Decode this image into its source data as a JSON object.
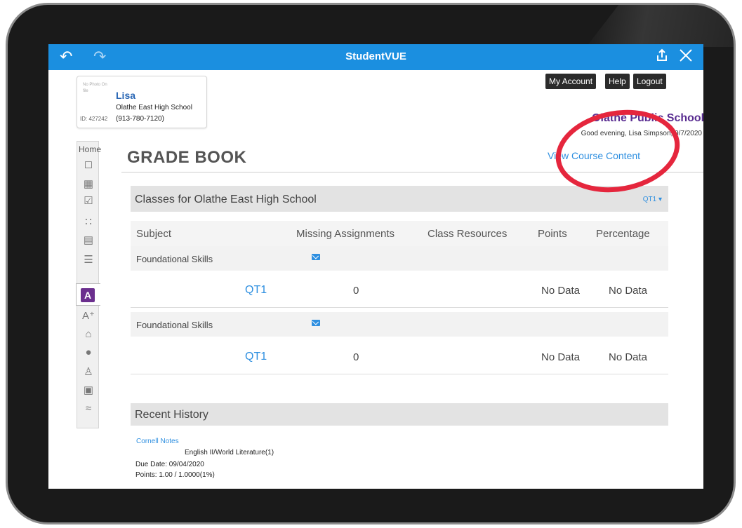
{
  "app": {
    "title": "StudentVUE",
    "back_icon": "back-arrow-icon",
    "forward_icon": "forward-arrow-icon",
    "share_icon": "share-icon",
    "close_icon": "close-icon"
  },
  "student": {
    "photo_text": "No Photo On file",
    "name": "Lisa",
    "school": "Olathe East High School",
    "id": "ID: 427242",
    "phone": "(913-780-7120)"
  },
  "header": {
    "my_account": "My Account",
    "help": "Help",
    "logout": "Logout",
    "district": "Olathe Public Schools",
    "greeting": "Good evening, Lisa Simpson, 9/7/2020"
  },
  "sidebar": {
    "home_label": "Home",
    "icons": [
      "home-icon",
      "calendar-icon",
      "attendance-icon",
      "assessment-icon",
      "class-schedule-icon",
      "course-history-icon",
      "grade-book-icon",
      "report-card-icon",
      "school-info-icon",
      "student-info-icon",
      "conference-icon",
      "lock-icon",
      "test-history-icon"
    ]
  },
  "page": {
    "title": "GRADE BOOK",
    "view_course_content": "View Course Content"
  },
  "classes": {
    "header": "Classes for Olathe East High School",
    "period_selector": "QT1",
    "columns": [
      "Subject",
      "Missing Assignments",
      "Class Resources",
      "Points",
      "Percentage"
    ],
    "groups": [
      {
        "subject": "Foundational Skills",
        "rows": [
          {
            "period": "QT1",
            "missing": "0",
            "points": "No Data",
            "percentage": "No Data"
          }
        ]
      },
      {
        "subject": "Foundational Skills",
        "rows": [
          {
            "period": "QT1",
            "missing": "0",
            "points": "No Data",
            "percentage": "No Data"
          }
        ]
      }
    ]
  },
  "recent_history": {
    "header": "Recent History",
    "items": [
      {
        "title": "Cornell Notes",
        "course": "English II/World Literature(1)",
        "due": "Due Date: 09/04/2020",
        "points": "Points: 1.00 / 1.0000(1%)"
      }
    ]
  },
  "colors": {
    "topbar": "#1b8fe0",
    "link": "#2e8fe0",
    "district": "#5a2d91",
    "annotation_circle": "#e5263d",
    "active_icon": "#6b2f8e"
  }
}
